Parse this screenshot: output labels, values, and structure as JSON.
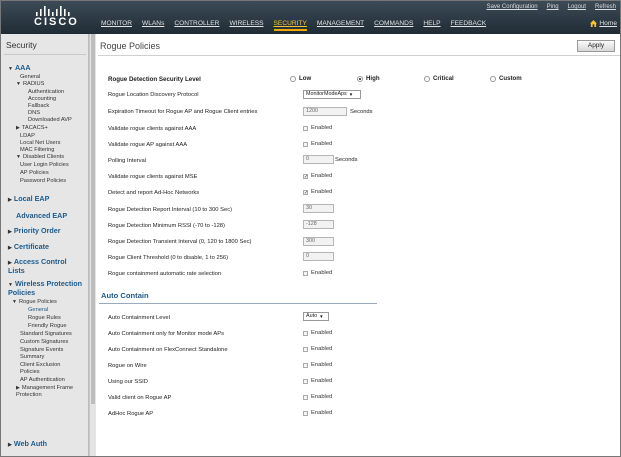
{
  "header": {
    "logo": "CISCO",
    "top_links": [
      "Save Configuration",
      "Ping",
      "Logout",
      "Refresh"
    ],
    "nav": [
      "MONITOR",
      "WLANs",
      "CONTROLLER",
      "WIRELESS",
      "SECURITY",
      "MANAGEMENT",
      "COMMANDS",
      "HELP",
      "FEEDBACK"
    ],
    "active_nav": "SECURITY",
    "home": "Home"
  },
  "sidebar": {
    "title": "Security",
    "aaa": "AAA",
    "aaa_items": [
      "General",
      "RADIUS",
      "Authentication",
      "Accounting",
      "Fallback",
      "DNS",
      "Downloaded AVP",
      "TACACS+",
      "LDAP",
      "Local Net Users",
      "MAC Filtering",
      "Disabled Clients",
      "User Login Policies",
      "AP Policies",
      "Password Policies"
    ],
    "local_eap": "Local EAP",
    "advanced_eap": "Advanced EAP",
    "priority_order": "Priority Order",
    "certificate": "Certificate",
    "acl": "Access Control Lists",
    "wpp": "Wireless Protection Policies",
    "wpp_items": [
      "Rogue Policies",
      "General",
      "Rogue Rules",
      "Friendly Rogue",
      "Standard Signatures",
      "Custom Signatures",
      "Signature Events Summary",
      "Client Exclusion Policies",
      "AP Authentication",
      "Management Frame Protection"
    ],
    "web_auth": "Web Auth"
  },
  "main": {
    "title": "Rogue Policies",
    "apply": "Apply",
    "security_level": {
      "label": "Rogue Detection Security Level",
      "options": [
        "Low",
        "High",
        "Critical",
        "Custom"
      ],
      "selected": "High"
    },
    "fields": {
      "location_protocol": {
        "label": "Rogue Location Discovery Protocol",
        "value": "MonitorModeAps"
      },
      "expiration": {
        "label": "Expiration Timeout for Rogue AP and Rogue Client entries",
        "value": "1200",
        "unit": "Seconds"
      },
      "validate_clients_aaa": {
        "label": "Validate rogue clients against AAA",
        "checked": false
      },
      "validate_ap_aaa": {
        "label": "Validate rogue AP against AAA",
        "checked": false
      },
      "polling": {
        "label": "Polling Interval",
        "value": "0",
        "unit": "Seconds"
      },
      "validate_mse": {
        "label": "Validate rogue clients against MSE",
        "checked": true
      },
      "adhoc": {
        "label": "Detect and report Ad-Hoc Networks",
        "checked": true
      },
      "report_interval": {
        "label": "Rogue Detection Report Interval (10 to 300 Sec)",
        "value": "30"
      },
      "min_rssi": {
        "label": "Rogue Detection Minimum RSSI (-70 to -128)",
        "value": "-128"
      },
      "transient": {
        "label": "Rogue Detection Transient Interval (0, 120 to 1800 Sec)",
        "value": "300"
      },
      "client_threshold": {
        "label": "Rogue Client Threshold (0 to disable, 1 to 256)",
        "value": "0"
      },
      "auto_rate": {
        "label": "Rogue containment automatic rate selection",
        "checked": false
      }
    },
    "enabled_text": "Enabled",
    "auto_contain": {
      "title": "Auto Contain",
      "level": {
        "label": "Auto Containment Level",
        "value": "Auto"
      },
      "items": [
        {
          "label": "Auto Containment only for Monitor mode APs",
          "checked": false
        },
        {
          "label": "Auto Containment on FlexConnect Standalone",
          "checked": false
        },
        {
          "label": "Rogue on Wire",
          "checked": false
        },
        {
          "label": "Using our SSID",
          "checked": false
        },
        {
          "label": "Valid client on Rogue AP",
          "checked": false
        },
        {
          "label": "AdHoc Rogue AP",
          "checked": false
        }
      ]
    }
  }
}
